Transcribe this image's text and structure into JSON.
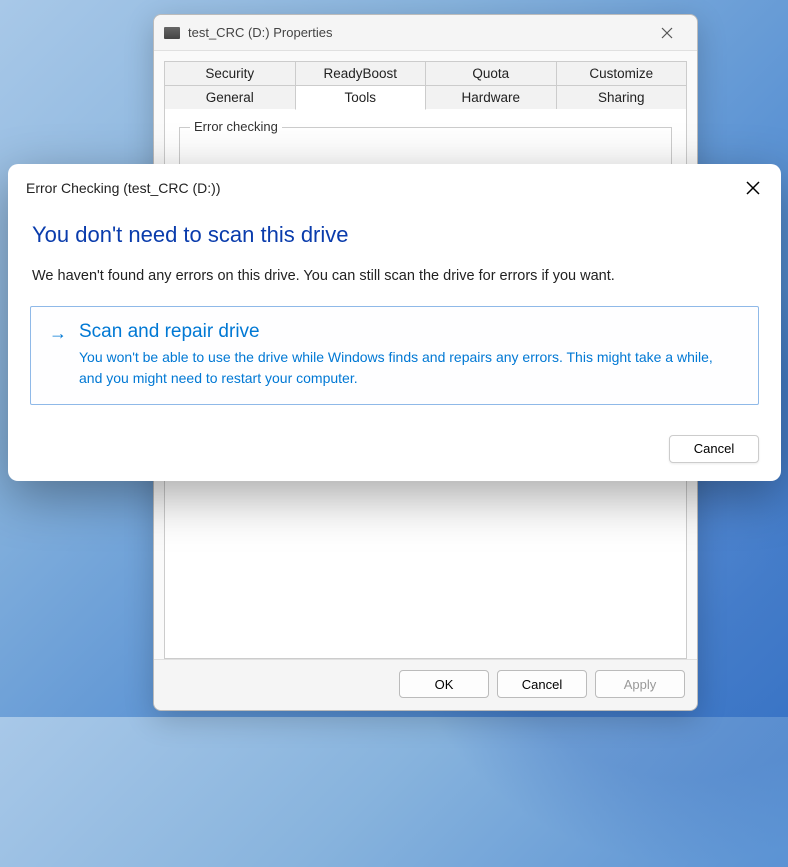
{
  "properties_window": {
    "title": "test_CRC (D:) Properties",
    "tabs_row1": [
      "Security",
      "ReadyBoost",
      "Quota",
      "Customize"
    ],
    "tabs_row2": [
      "General",
      "Tools",
      "Hardware",
      "Sharing"
    ],
    "active_tab": "Tools",
    "groupbox_label": "Error checking",
    "buttons": {
      "ok": "OK",
      "cancel": "Cancel",
      "apply": "Apply"
    }
  },
  "dialog": {
    "title": "Error Checking (test_CRC (D:))",
    "heading": "You don't need to scan this drive",
    "body": "We haven't found any errors on this drive. You can still scan the drive for errors if you want.",
    "command": {
      "title": "Scan and repair drive",
      "desc": "You won't be able to use the drive while Windows finds and repairs any errors. This might take a while, and you might need to restart your computer."
    },
    "cancel": "Cancel"
  }
}
